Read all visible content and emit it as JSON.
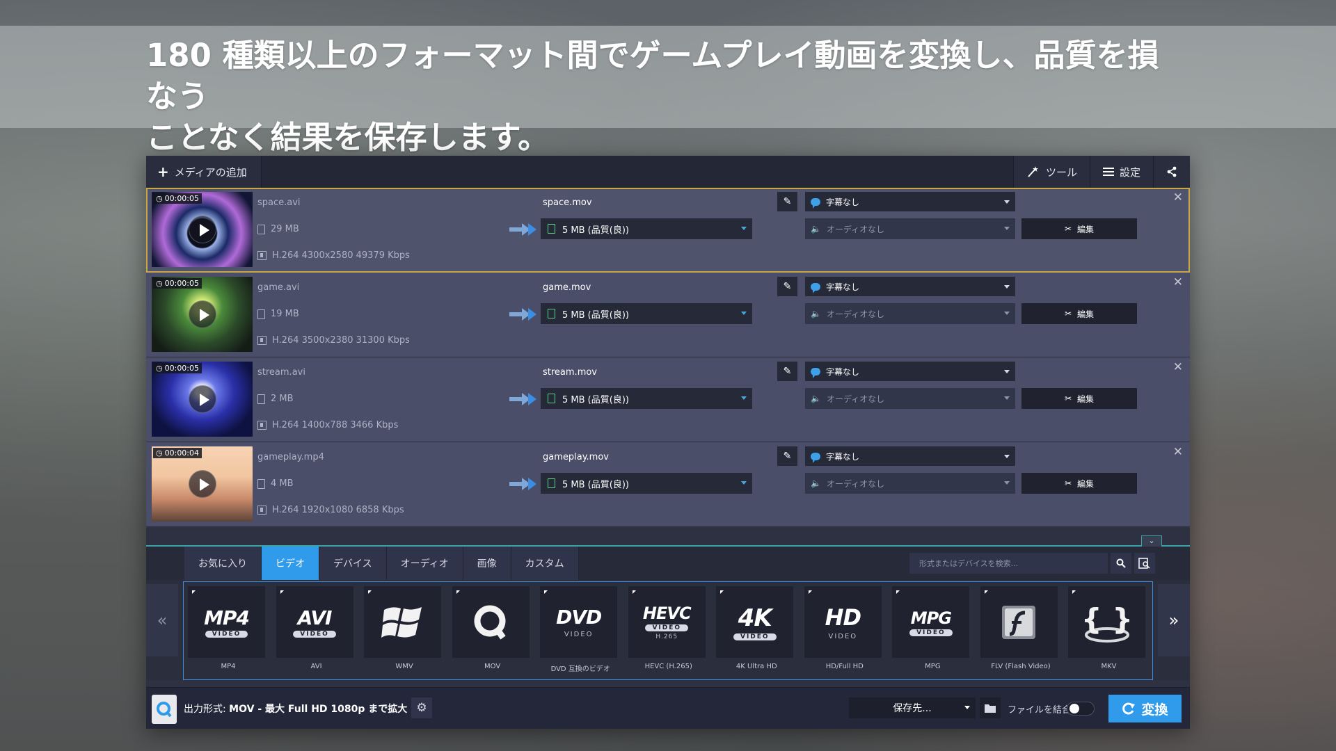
{
  "headline": {
    "line1": "180 種類以上のフォーマット間でゲームプレイ動画を変換し、品質を損なう",
    "line2": "ことなく結果を保存します。"
  },
  "topbar": {
    "add_media": "メディアの追加",
    "tools": "ツール",
    "settings": "設定"
  },
  "files": [
    {
      "duration": "00:00:05",
      "source_name": "space.avi",
      "source_size": "29 MB",
      "source_info": "H.264 4300x2580 49379 Kbps",
      "output_name": "space.mov",
      "output_size": "5 MB (品質(良))",
      "subtitle": "字幕なし",
      "audio": "オーディオなし",
      "edit": "編集"
    },
    {
      "duration": "00:00:05",
      "source_name": "game.avi",
      "source_size": "19 MB",
      "source_info": "H.264 3500x2380 31300 Kbps",
      "output_name": "game.mov",
      "output_size": "5 MB (品質(良))",
      "subtitle": "字幕なし",
      "audio": "オーディオなし",
      "edit": "編集"
    },
    {
      "duration": "00:00:05",
      "source_name": "stream.avi",
      "source_size": "2 MB",
      "source_info": "H.264 1400x788 3466 Kbps",
      "output_name": "stream.mov",
      "output_size": "5 MB (品質(良))",
      "subtitle": "字幕なし",
      "audio": "オーディオなし",
      "edit": "編集"
    },
    {
      "duration": "00:00:04",
      "source_name": "gameplay.mp4",
      "source_size": "4 MB",
      "source_info": "H.264 1920x1080 6858 Kbps",
      "output_name": "gameplay.mov",
      "output_size": "5 MB (品質(良))",
      "subtitle": "字幕なし",
      "audio": "オーディオなし",
      "edit": "編集"
    }
  ],
  "tabs": [
    "お気に入り",
    "ビデオ",
    "デバイス",
    "オーディオ",
    "画像",
    "カスタム"
  ],
  "search": {
    "placeholder": "形式またはデバイスを検索..."
  },
  "formats": [
    {
      "main": "MP4",
      "sub": "VIDEO",
      "label": "MP4"
    },
    {
      "main": "AVI",
      "sub": "VIDEO",
      "label": "AVI"
    },
    {
      "main": "",
      "sub": "",
      "label": "WMV",
      "icon": "windows-logo-icon"
    },
    {
      "main": "",
      "sub": "",
      "label": "MOV",
      "icon": "quicktime-logo-icon"
    },
    {
      "main": "DVD",
      "sub2": "VIDEO",
      "label": "DVD 互換のビデオ"
    },
    {
      "main": "HEVC",
      "sub": "VIDEO",
      "sub3": "H.265",
      "label": "HEVC (H.265)"
    },
    {
      "main": "4K",
      "sub": "VIDEO",
      "label": "4K Ultra HD"
    },
    {
      "main": "HD",
      "sub2": "VIDEO",
      "label": "HD/Full HD"
    },
    {
      "main": "MPG",
      "sub": "VIDEO",
      "label": "MPG"
    },
    {
      "main": "",
      "sub": "",
      "label": "FLV (Flash Video)",
      "icon": "flash-logo-icon"
    },
    {
      "main": "",
      "sub": "",
      "label": "MKV",
      "icon": "mkv-logo-icon"
    }
  ],
  "bottom": {
    "output_prefix": "出力形式:",
    "output_value": "MOV - 最大 Full HD 1080p まで拡大",
    "save_to": "保存先...",
    "merge_label": "ファイルを結合:",
    "convert": "変換"
  },
  "colors": {
    "accent": "#2f9bea",
    "selected_outline": "#c9a646",
    "row_bg": "#4b4e68",
    "app_bg": "#2d3142"
  }
}
